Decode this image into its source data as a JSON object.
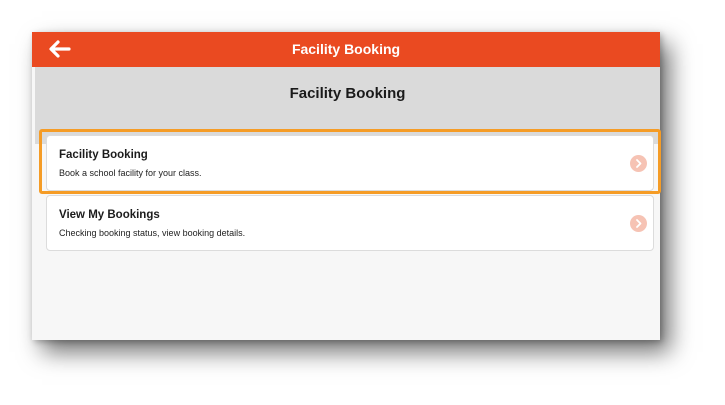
{
  "header": {
    "title": "Facility Booking",
    "back_icon": "arrow-left-icon",
    "color": "#ea4a21"
  },
  "subheader": {
    "title": "Facility Booking"
  },
  "menu": {
    "items": [
      {
        "title": "Facility Booking",
        "description": "Book a school facility for your class.",
        "icon": "chevron-right-icon"
      },
      {
        "title": "View My Bookings",
        "description": "Checking booking status, view booking details.",
        "icon": "chevron-right-icon"
      }
    ]
  },
  "colors": {
    "accent": "#ea4a21",
    "highlight": "#f59c26",
    "subheader_bg": "#dadada",
    "chevron_bg": "#f6c3b4"
  }
}
